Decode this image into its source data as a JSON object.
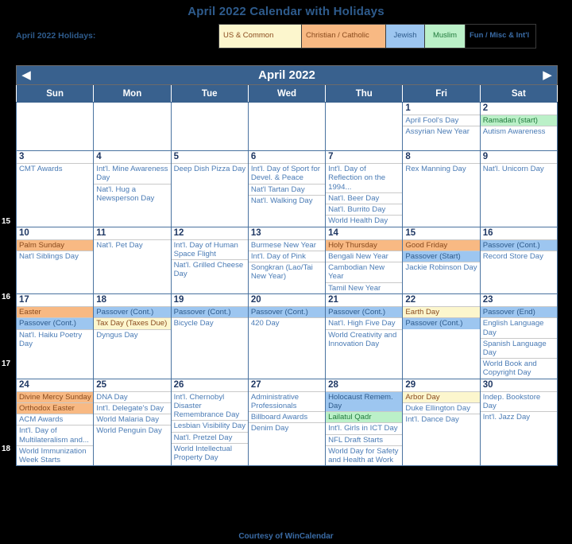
{
  "page_title": "April 2022 Calendar with Holidays",
  "legend": {
    "label": "April 2022 Holidays:",
    "items": [
      {
        "key": "us",
        "text": "US & Common"
      },
      {
        "key": "ch",
        "text": "Christian / Catholic"
      },
      {
        "key": "je",
        "text": "Jewish"
      },
      {
        "key": "mu",
        "text": "Muslim"
      },
      {
        "key": "fu",
        "text": "Fun / Misc & Int'l"
      }
    ]
  },
  "nav": {
    "prev_icon": "◀",
    "next_icon": "▶",
    "month_title": "April 2022"
  },
  "weekday_headers": [
    "Sun",
    "Mon",
    "Tue",
    "Wed",
    "Thu",
    "Fri",
    "Sat"
  ],
  "colors": {
    "us_common": "#FCF6CD",
    "christian": "#F8B983",
    "jewish": "#9DC6F0",
    "muslim": "#BBF0C8",
    "header_blue": "#39618E",
    "weekend_cell": "#FCFAE0",
    "blank_cell": "#D6D6D6",
    "event_text": "#4A7BB5",
    "title_blue": "#2E5B8C"
  },
  "footer": "Courtesy of WinCalendar",
  "weeks": [
    {
      "week_number": "",
      "days": [
        {
          "num": "",
          "blank": true,
          "weekend": true,
          "events": []
        },
        {
          "num": "",
          "blank": true,
          "weekend": false,
          "events": []
        },
        {
          "num": "",
          "blank": true,
          "weekend": false,
          "events": []
        },
        {
          "num": "",
          "blank": true,
          "weekend": false,
          "events": []
        },
        {
          "num": "",
          "blank": true,
          "weekend": false,
          "events": []
        },
        {
          "num": "1",
          "blank": false,
          "weekend": false,
          "events": [
            {
              "text": "April Fool's Day",
              "cat": "fu"
            },
            {
              "text": "Assyrian New Year",
              "cat": "fu"
            }
          ]
        },
        {
          "num": "2",
          "blank": false,
          "weekend": true,
          "events": [
            {
              "text": "Ramadan (start)",
              "cat": "mu"
            },
            {
              "text": "Autism Awareness",
              "cat": "fu"
            }
          ]
        }
      ]
    },
    {
      "week_number": "15",
      "days": [
        {
          "num": "3",
          "blank": false,
          "weekend": true,
          "events": [
            {
              "text": "CMT Awards",
              "cat": "fu"
            }
          ]
        },
        {
          "num": "4",
          "blank": false,
          "weekend": false,
          "events": [
            {
              "text": "Int'l. Mine Awareness Day",
              "cat": "fu"
            },
            {
              "text": "Nat'l. Hug a Newsperson Day",
              "cat": "fu"
            }
          ]
        },
        {
          "num": "5",
          "blank": false,
          "weekend": false,
          "events": [
            {
              "text": "Deep Dish Pizza Day",
              "cat": "fu"
            }
          ]
        },
        {
          "num": "6",
          "blank": false,
          "weekend": false,
          "events": [
            {
              "text": "Int'l. Day of Sport for Devel. & Peace",
              "cat": "fu"
            },
            {
              "text": "Nat'l Tartan Day",
              "cat": "fu"
            },
            {
              "text": "Nat'l. Walking Day",
              "cat": "fu"
            }
          ]
        },
        {
          "num": "7",
          "blank": false,
          "weekend": false,
          "events": [
            {
              "text": "Int'l. Day of Reflection on the 1994...",
              "cat": "fu"
            },
            {
              "text": "Nat'l. Beer Day",
              "cat": "fu"
            },
            {
              "text": "Nat'l. Burrito Day",
              "cat": "fu"
            },
            {
              "text": "World Health Day",
              "cat": "fu"
            }
          ]
        },
        {
          "num": "8",
          "blank": false,
          "weekend": false,
          "events": [
            {
              "text": "Rex Manning Day",
              "cat": "fu"
            }
          ]
        },
        {
          "num": "9",
          "blank": false,
          "weekend": true,
          "events": [
            {
              "text": "Nat'l. Unicorn Day",
              "cat": "fu"
            }
          ]
        }
      ]
    },
    {
      "week_number": "16",
      "days": [
        {
          "num": "10",
          "blank": false,
          "weekend": true,
          "events": [
            {
              "text": "Palm Sunday",
              "cat": "ch"
            },
            {
              "text": "Nat'l Siblings Day",
              "cat": "fu"
            }
          ]
        },
        {
          "num": "11",
          "blank": false,
          "weekend": false,
          "events": [
            {
              "text": "Nat'l. Pet Day",
              "cat": "fu"
            }
          ]
        },
        {
          "num": "12",
          "blank": false,
          "weekend": false,
          "events": [
            {
              "text": "Int'l. Day of Human Space Flight",
              "cat": "fu"
            },
            {
              "text": "Nat'l. Grilled Cheese Day",
              "cat": "fu"
            }
          ]
        },
        {
          "num": "13",
          "blank": false,
          "weekend": false,
          "events": [
            {
              "text": "Burmese New Year",
              "cat": "fu"
            },
            {
              "text": "Int'l. Day of Pink",
              "cat": "fu"
            },
            {
              "text": "Songkran (Lao/Tai New Year)",
              "cat": "fu"
            }
          ]
        },
        {
          "num": "14",
          "blank": false,
          "weekend": false,
          "events": [
            {
              "text": "Holy Thursday",
              "cat": "ch"
            },
            {
              "text": "Bengali New Year",
              "cat": "fu"
            },
            {
              "text": "Cambodian New Year",
              "cat": "fu"
            },
            {
              "text": "Tamil New Year",
              "cat": "fu"
            }
          ]
        },
        {
          "num": "15",
          "blank": false,
          "weekend": false,
          "events": [
            {
              "text": "Good Friday",
              "cat": "ch"
            },
            {
              "text": "Passover (Start)",
              "cat": "je"
            },
            {
              "text": "Jackie Robinson Day",
              "cat": "fu"
            }
          ]
        },
        {
          "num": "16",
          "blank": false,
          "weekend": true,
          "events": [
            {
              "text": "Passover (Cont.)",
              "cat": "je"
            },
            {
              "text": "Record Store Day",
              "cat": "fu"
            }
          ]
        }
      ]
    },
    {
      "week_number": "17",
      "days": [
        {
          "num": "17",
          "blank": false,
          "weekend": true,
          "events": [
            {
              "text": "Easter",
              "cat": "ch"
            },
            {
              "text": "Passover (Cont.)",
              "cat": "je"
            },
            {
              "text": "Nat'l. Haiku Poetry Day",
              "cat": "fu"
            }
          ]
        },
        {
          "num": "18",
          "blank": false,
          "weekend": false,
          "events": [
            {
              "text": "Passover (Cont.)",
              "cat": "je"
            },
            {
              "text": "Tax Day (Taxes Due)",
              "cat": "us"
            },
            {
              "text": "Dyngus Day",
              "cat": "fu"
            }
          ]
        },
        {
          "num": "19",
          "blank": false,
          "weekend": false,
          "events": [
            {
              "text": "Passover (Cont.)",
              "cat": "je"
            },
            {
              "text": "Bicycle Day",
              "cat": "fu"
            }
          ]
        },
        {
          "num": "20",
          "blank": false,
          "weekend": false,
          "events": [
            {
              "text": "Passover (Cont.)",
              "cat": "je"
            },
            {
              "text": "420 Day",
              "cat": "fu"
            }
          ]
        },
        {
          "num": "21",
          "blank": false,
          "weekend": false,
          "events": [
            {
              "text": "Passover (Cont.)",
              "cat": "je"
            },
            {
              "text": "Nat'l. High Five Day",
              "cat": "fu"
            },
            {
              "text": "World Creativity and Innovation Day",
              "cat": "fu"
            }
          ]
        },
        {
          "num": "22",
          "blank": false,
          "weekend": false,
          "events": [
            {
              "text": "Earth Day",
              "cat": "us"
            },
            {
              "text": "Passover (Cont.)",
              "cat": "je"
            }
          ]
        },
        {
          "num": "23",
          "blank": false,
          "weekend": true,
          "events": [
            {
              "text": "Passover (End)",
              "cat": "je"
            },
            {
              "text": "English Language Day",
              "cat": "fu"
            },
            {
              "text": "Spanish Language Day",
              "cat": "fu"
            },
            {
              "text": "World Book and Copyright Day",
              "cat": "fu"
            }
          ]
        }
      ]
    },
    {
      "week_number": "18",
      "days": [
        {
          "num": "24",
          "blank": false,
          "weekend": true,
          "events": [
            {
              "text": "Divine Mercy Sunday",
              "cat": "ch"
            },
            {
              "text": "Orthodox Easter",
              "cat": "ch"
            },
            {
              "text": "ACM Awards",
              "cat": "fu"
            },
            {
              "text": "Int'l. Day of Multilateralism and...",
              "cat": "fu"
            },
            {
              "text": "World Immunization Week Starts",
              "cat": "fu"
            }
          ]
        },
        {
          "num": "25",
          "blank": false,
          "weekend": false,
          "events": [
            {
              "text": "DNA Day",
              "cat": "fu"
            },
            {
              "text": "Int'l. Delegate's Day",
              "cat": "fu"
            },
            {
              "text": "World Malaria Day",
              "cat": "fu"
            },
            {
              "text": "World Penguin Day",
              "cat": "fu"
            }
          ]
        },
        {
          "num": "26",
          "blank": false,
          "weekend": false,
          "events": [
            {
              "text": "Int'l. Chernobyl Disaster Remembrance Day",
              "cat": "fu"
            },
            {
              "text": "Lesbian Visibility Day",
              "cat": "fu"
            },
            {
              "text": "Nat'l. Pretzel Day",
              "cat": "fu"
            },
            {
              "text": "World Intellectual Property Day",
              "cat": "fu"
            }
          ]
        },
        {
          "num": "27",
          "blank": false,
          "weekend": false,
          "events": [
            {
              "text": "Administrative Professionals",
              "cat": "fu"
            },
            {
              "text": "Billboard Awards",
              "cat": "fu"
            },
            {
              "text": "Denim Day",
              "cat": "fu"
            }
          ]
        },
        {
          "num": "28",
          "blank": false,
          "weekend": false,
          "events": [
            {
              "text": "Holocaust Remem. Day",
              "cat": "je"
            },
            {
              "text": "Lailatul Qadr",
              "cat": "mu"
            },
            {
              "text": "Int'l. Girls in ICT Day",
              "cat": "fu"
            },
            {
              "text": "NFL Draft Starts",
              "cat": "fu"
            },
            {
              "text": "World Day for Safety and Health at Work",
              "cat": "fu"
            }
          ]
        },
        {
          "num": "29",
          "blank": false,
          "weekend": false,
          "events": [
            {
              "text": "Arbor Day",
              "cat": "us"
            },
            {
              "text": "Duke Ellington Day",
              "cat": "fu"
            },
            {
              "text": "Int'l. Dance Day",
              "cat": "fu"
            }
          ]
        },
        {
          "num": "30",
          "blank": false,
          "weekend": true,
          "events": [
            {
              "text": "Indep. Bookstore Day",
              "cat": "fu"
            },
            {
              "text": "Int'l. Jazz Day",
              "cat": "fu"
            }
          ]
        }
      ]
    }
  ]
}
